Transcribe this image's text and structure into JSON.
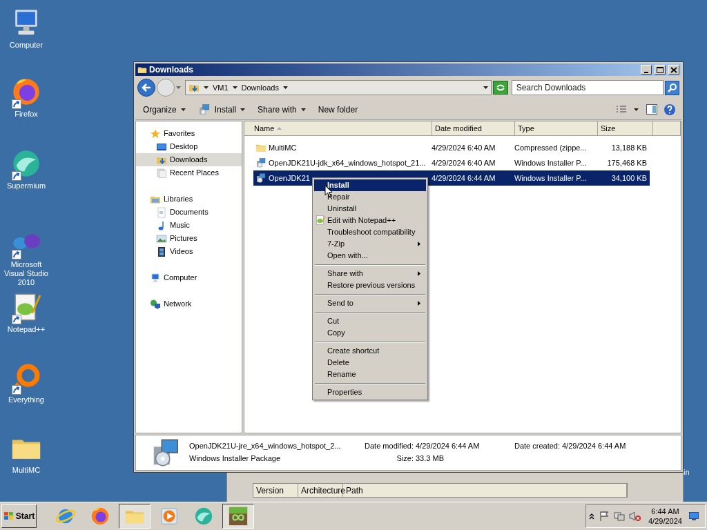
{
  "desktop": {
    "icons": [
      {
        "label": "Computer",
        "shortcut": false
      },
      {
        "label": "Firefox",
        "shortcut": true
      },
      {
        "label": "Supermium",
        "shortcut": true
      },
      {
        "label": "Microsoft Visual Studio 2010",
        "shortcut": true
      },
      {
        "label": "Notepad++",
        "shortcut": true
      },
      {
        "label": "Everything",
        "shortcut": true
      },
      {
        "label": "MultiMC",
        "shortcut": false
      }
    ],
    "partial_label": "in"
  },
  "background_window": {
    "columns": [
      "Version",
      "Architecture",
      "Path"
    ]
  },
  "explorer": {
    "title": "Downloads",
    "address": {
      "segments": [
        "VM1",
        "Downloads"
      ]
    },
    "search": {
      "placeholder": "Search Downloads"
    },
    "toolbar": [
      {
        "label": "Organize",
        "dropdown": true
      },
      {
        "label": "Install",
        "dropdown": true
      },
      {
        "label": "Share with",
        "dropdown": true
      },
      {
        "label": "New folder",
        "dropdown": false
      }
    ],
    "navigation": [
      {
        "label": "Favorites",
        "children": [
          {
            "label": "Desktop",
            "selected": false
          },
          {
            "label": "Downloads",
            "selected": true
          },
          {
            "label": "Recent Places",
            "selected": false
          }
        ]
      },
      {
        "label": "Libraries",
        "children": [
          {
            "label": "Documents",
            "selected": false
          },
          {
            "label": "Music",
            "selected": false
          },
          {
            "label": "Pictures",
            "selected": false
          },
          {
            "label": "Videos",
            "selected": false
          }
        ]
      },
      {
        "label": "Computer"
      },
      {
        "label": "Network"
      }
    ],
    "columns": [
      {
        "label": "Name",
        "sorted": true
      },
      {
        "label": "Date modified",
        "sorted": false
      },
      {
        "label": "Type",
        "sorted": false
      },
      {
        "label": "Size",
        "sorted": false
      }
    ],
    "rows": [
      {
        "name": "MultiMC",
        "kind": "folder",
        "date_modified": "4/29/2024 6:40 AM",
        "type": "Compressed (zippe...",
        "size": "13,188 KB",
        "selected": false
      },
      {
        "name": "OpenJDK21U-jdk_x64_windows_hotspot_21...",
        "kind": "installer",
        "date_modified": "4/29/2024 6:40 AM",
        "type": "Windows Installer P...",
        "size": "175,468 KB",
        "selected": false
      },
      {
        "name": "OpenJDK21",
        "kind": "installer",
        "date_modified": "4/29/2024 6:44 AM",
        "type": "Windows Installer P...",
        "size": "34,100 KB",
        "selected": true
      }
    ],
    "details": {
      "name": "OpenJDK21U-jre_x64_windows_hotspot_2...",
      "type": "Windows Installer Package",
      "fields": [
        {
          "label": "Date modified:",
          "value": "4/29/2024 6:44 AM"
        },
        {
          "label": "Date created:",
          "value": "4/29/2024 6:44 AM"
        },
        {
          "label": "Size:",
          "value": "33.3 MB"
        }
      ]
    }
  },
  "context_menu": {
    "items": [
      {
        "kind": "item",
        "label": "Install",
        "default": true,
        "selected": true,
        "submenu": false
      },
      {
        "kind": "item",
        "label": "Repair",
        "default": false,
        "selected": false,
        "submenu": false
      },
      {
        "kind": "item",
        "label": "Uninstall",
        "default": false,
        "selected": false,
        "submenu": false
      },
      {
        "kind": "item",
        "label": "Edit with Notepad++",
        "default": false,
        "selected": false,
        "submenu": false
      },
      {
        "kind": "item",
        "label": "Troubleshoot compatibility",
        "default": false,
        "selected": false,
        "submenu": false
      },
      {
        "kind": "item",
        "label": "7-Zip",
        "default": false,
        "selected": false,
        "submenu": true
      },
      {
        "kind": "item",
        "label": "Open with...",
        "default": false,
        "selected": false,
        "submenu": false
      },
      {
        "kind": "separator"
      },
      {
        "kind": "item",
        "label": "Share with",
        "default": false,
        "selected": false,
        "submenu": true
      },
      {
        "kind": "item",
        "label": "Restore previous versions",
        "default": false,
        "selected": false,
        "submenu": false
      },
      {
        "kind": "separator"
      },
      {
        "kind": "item",
        "label": "Send to",
        "default": false,
        "selected": false,
        "submenu": true
      },
      {
        "kind": "separator"
      },
      {
        "kind": "item",
        "label": "Cut",
        "default": false,
        "selected": false,
        "submenu": false
      },
      {
        "kind": "item",
        "label": "Copy",
        "default": false,
        "selected": false,
        "submenu": false
      },
      {
        "kind": "separator"
      },
      {
        "kind": "item",
        "label": "Create shortcut",
        "default": false,
        "selected": false,
        "submenu": false
      },
      {
        "kind": "item",
        "label": "Delete",
        "default": false,
        "selected": false,
        "submenu": false
      },
      {
        "kind": "item",
        "label": "Rename",
        "default": false,
        "selected": false,
        "submenu": false
      },
      {
        "kind": "separator"
      },
      {
        "kind": "item",
        "label": "Properties",
        "default": false,
        "selected": false,
        "submenu": false
      }
    ]
  },
  "taskbar": {
    "start": "Start",
    "apps": [
      {
        "active": false
      },
      {
        "active": false
      },
      {
        "active": true
      },
      {
        "active": false
      },
      {
        "active": false
      },
      {
        "active": true
      }
    ],
    "time": "6:44 AM",
    "date": "4/29/2024"
  }
}
